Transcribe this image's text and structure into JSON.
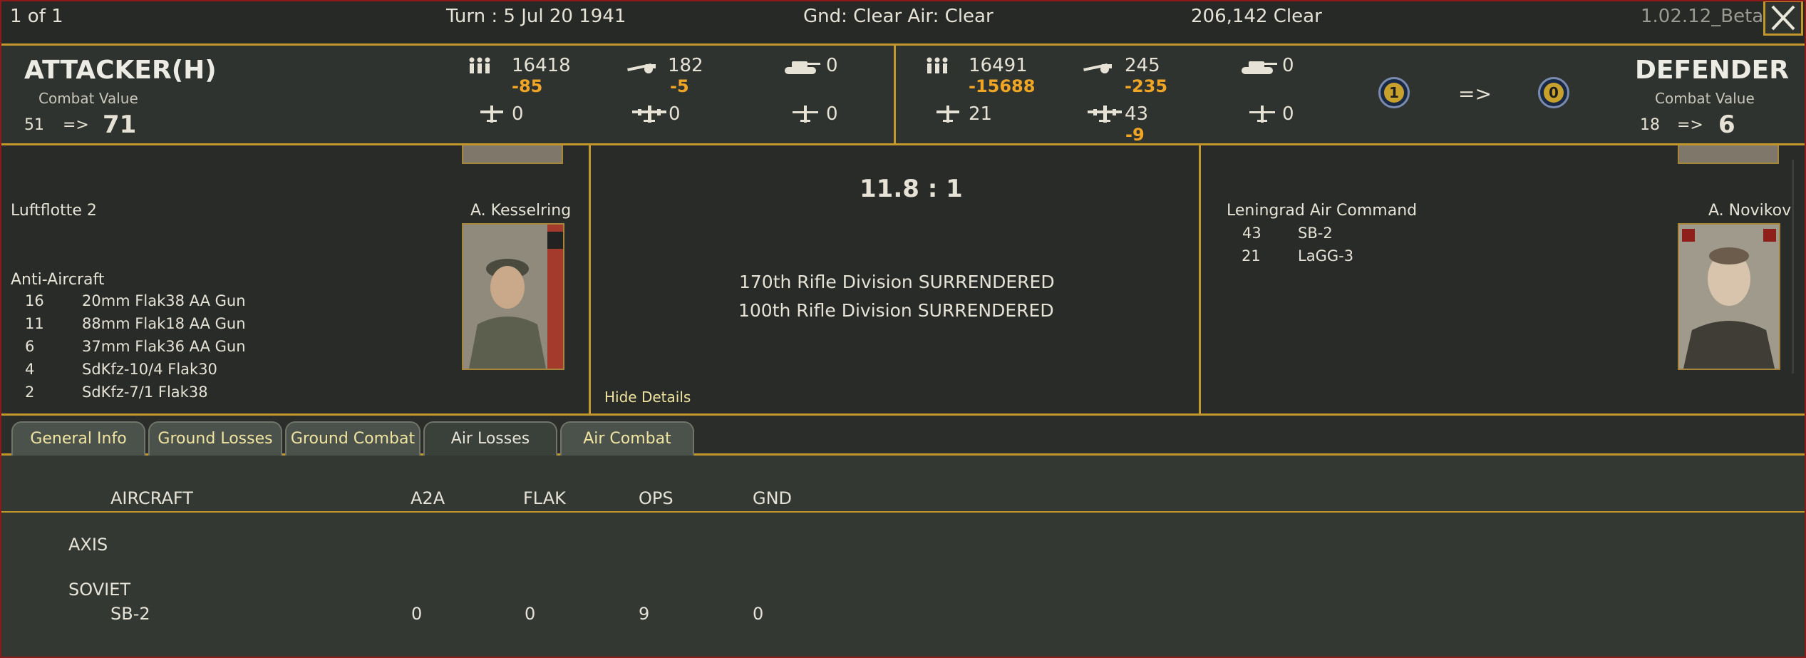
{
  "topbar": {
    "page_count": "1 of 1",
    "turn": "Turn : 5   Jul 20 1941",
    "weather": "Gnd: Clear  Air: Clear",
    "location": "206,142   Clear",
    "version": "1.02.12_Beta"
  },
  "attacker": {
    "title": "ATTACKER(H)",
    "cv_label": "Combat Value",
    "cv_from": "51",
    "arrow": "=>",
    "cv_to": "71",
    "men": "16418",
    "men_loss": "-85",
    "guns": "182",
    "guns_loss": "-5",
    "afv": "0",
    "fighters": "0",
    "bombers": "0",
    "recon": "0"
  },
  "defender": {
    "title": "DEFENDER",
    "cv_label": "Combat Value",
    "cv_from": "18",
    "arrow": "=>",
    "cv_to": "6",
    "men": "16491",
    "men_loss": "-15688",
    "guns": "245",
    "guns_loss": "-235",
    "afv": "0",
    "fighters": "21",
    "bombers": "43",
    "bombers_loss": "-9",
    "recon": "0"
  },
  "medals": {
    "attacker": "1",
    "arrow": "=>",
    "defender": "0"
  },
  "attacker_detail": {
    "unit": "Luftflotte 2",
    "commander": "A. Kesselring",
    "section": "Anti-Aircraft",
    "rows": [
      {
        "count": "16",
        "name": "20mm Flak38 AA Gun"
      },
      {
        "count": "11",
        "name": "88mm Flak18 AA Gun"
      },
      {
        "count": "6",
        "name": "37mm Flak36 AA Gun"
      },
      {
        "count": "4",
        "name": "SdKfz-10/4 Flak30"
      },
      {
        "count": "2",
        "name": "SdKfz-7/1 Flak38"
      }
    ]
  },
  "center": {
    "odds": "11.8 : 1",
    "messages": [
      "170th Rifle Division SURRENDERED",
      "100th Rifle Division SURRENDERED"
    ],
    "hide_details": "Hide Details"
  },
  "defender_detail": {
    "unit": "Leningrad Air Command",
    "commander": "A. Novikov",
    "rows": [
      {
        "count": "43",
        "name": "SB-2"
      },
      {
        "count": "21",
        "name": "LaGG-3"
      }
    ]
  },
  "tabs": [
    "General Info",
    "Ground Losses",
    "Ground Combat",
    "Air Losses",
    "Air Combat"
  ],
  "active_tab": "Air Losses",
  "table": {
    "headers": [
      "AIRCRAFT",
      "A2A",
      "FLAK",
      "OPS",
      "GND"
    ],
    "groups": [
      {
        "name": "AXIS",
        "rows": []
      },
      {
        "name": "SOVIET",
        "rows": [
          {
            "aircraft": "SB-2",
            "a2a": "0",
            "flak": "0",
            "ops": "9",
            "gnd": "0"
          }
        ]
      }
    ]
  },
  "colors": {
    "gold": "#c3982a",
    "loss": "#f0a524",
    "frame": "#8d1a1a",
    "link": "#f0e4a0"
  },
  "icons": [
    "men-icon",
    "gun-icon",
    "tank-icon",
    "fighter-icon",
    "bomber-icon",
    "recon-icon",
    "close-icon"
  ]
}
